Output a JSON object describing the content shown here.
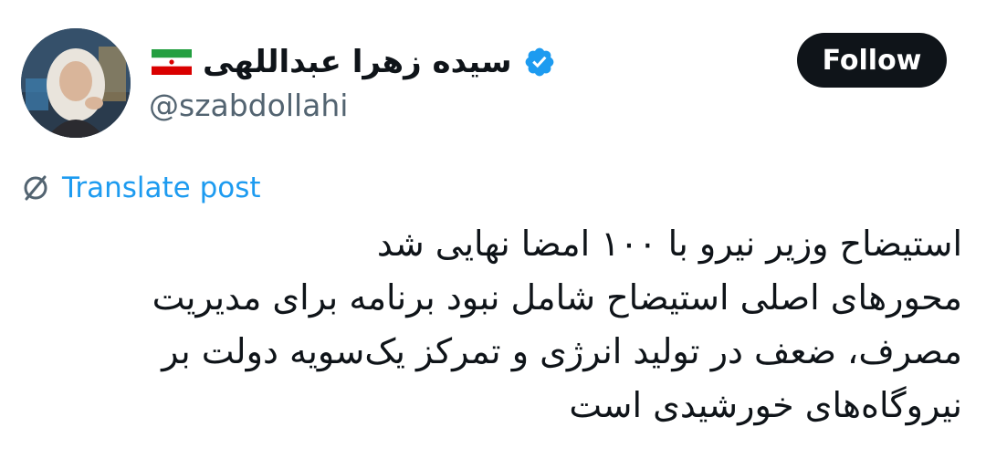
{
  "author": {
    "display_name": "سیده زهرا عبداللهی",
    "handle": "@szabdollahi",
    "flag_icon": "iran-flag-icon",
    "verified_icon": "verified-badge-icon"
  },
  "actions": {
    "follow_label": "Follow"
  },
  "translate": {
    "label": "Translate post",
    "icon": "translate-globe-icon"
  },
  "post": {
    "lines": [
      "استیضاح وزیر نیرو با ۱۰۰ امضا نهایی شد",
      "محورهای اصلی استیضاح شامل نبود برنامه برای مدیریت",
      "مصرف، ضعف در تولید انرژی و تمرکز یک‌سویه دولت بر",
      "نیروگاه‌های خورشیدی است"
    ]
  },
  "colors": {
    "text": "#0f1419",
    "secondary": "#536471",
    "accent": "#1d9bf0",
    "button_bg": "#0f1419",
    "button_text": "#ffffff"
  }
}
